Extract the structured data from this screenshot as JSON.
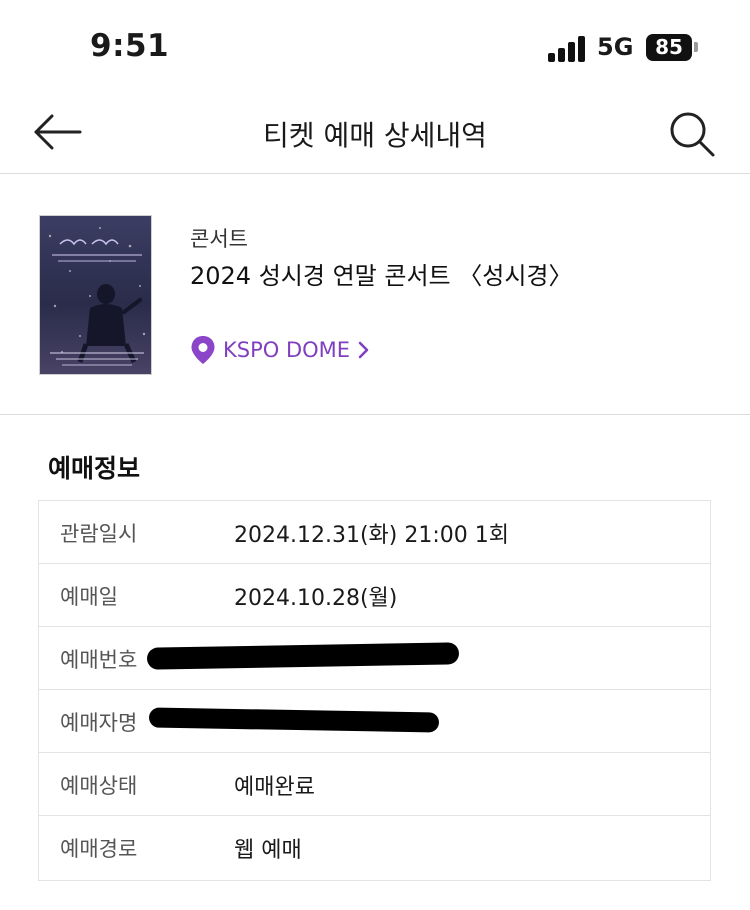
{
  "status_bar": {
    "time": "9:51",
    "network": "5G",
    "battery": "85"
  },
  "header": {
    "title": "티켓 예매 상세내역",
    "back_icon": "arrow-left-icon",
    "search_icon": "search-icon"
  },
  "event": {
    "category": "콘서트",
    "title": "2024 성시경 연말 콘서트 〈성시경〉",
    "venue": "KSPO DOME",
    "accent_color": "#7f3fbf"
  },
  "booking_info": {
    "heading": "예매정보",
    "rows": [
      {
        "label": "관람일시",
        "value": "2024.12.31(화) 21:00 1회"
      },
      {
        "label": "예매일",
        "value": "2024.10.28(월)"
      },
      {
        "label": "예매번호",
        "value": ""
      },
      {
        "label": "예매자명",
        "value": ""
      },
      {
        "label": "예매상태",
        "value": "예매완료"
      },
      {
        "label": "예매경로",
        "value": "웹 예매"
      }
    ]
  }
}
